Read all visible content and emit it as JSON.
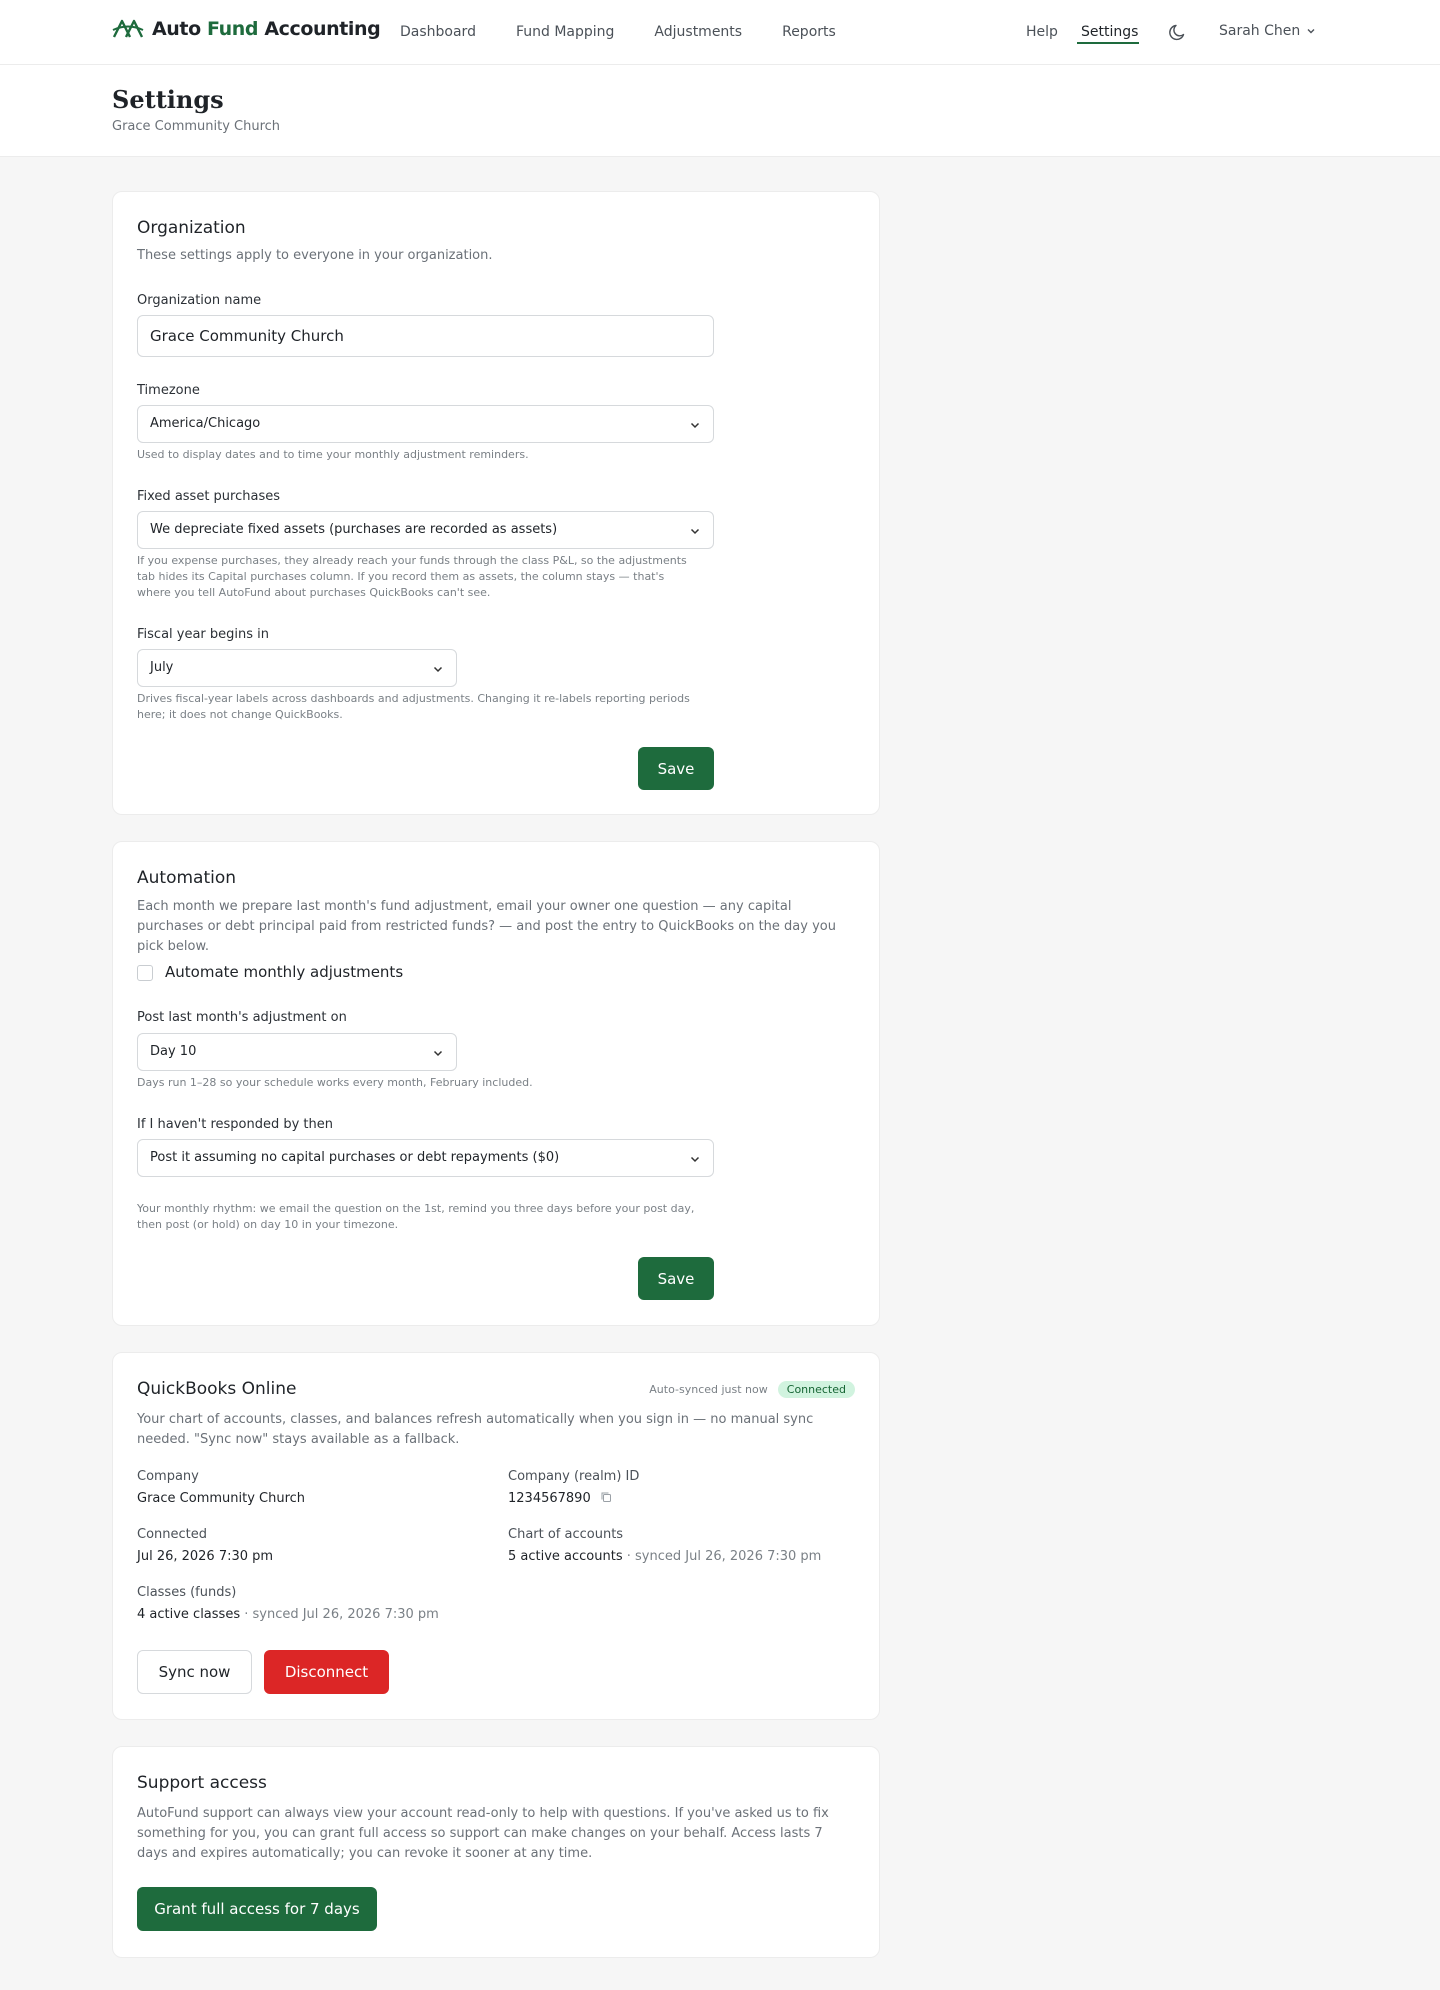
{
  "app": {
    "logo_prefix": "Auto",
    "logo_accent": "Fund",
    "logo_suffix": "Accounting",
    "brand_color": "#1e6b3d",
    "danger_color": "#dc2626"
  },
  "nav": {
    "links": [
      "Dashboard",
      "Fund Mapping",
      "Adjustments",
      "Reports"
    ],
    "help": "Help",
    "settings": "Settings",
    "theme_icon": "moon-icon",
    "user": "Sarah Chen"
  },
  "page": {
    "title": "Settings",
    "subtitle": "Grace Community Church"
  },
  "organization": {
    "title": "Organization",
    "description": "These settings apply to everyone in your organization.",
    "name_label": "Organization name",
    "name_value": "Grace Community Church",
    "timezone_label": "Timezone",
    "timezone_value": "America/Chicago",
    "timezone_help": "Used to display dates and to time your monthly adjustment reminders.",
    "fixed_asset_label": "Fixed asset purchases",
    "fixed_asset_value": "We depreciate fixed assets (purchases are recorded as assets)",
    "fixed_asset_help": "If you expense purchases, they already reach your funds through the class P&L, so the adjustments tab hides its Capital purchases column. If you record them as assets, the column stays — that's where you tell AutoFund about purchases QuickBooks can't see.",
    "fiscal_label": "Fiscal year begins in",
    "fiscal_value": "July",
    "fiscal_help": "Drives fiscal-year labels across dashboards and adjustments. Changing it re-labels reporting periods here; it does not change QuickBooks.",
    "save_label": "Save"
  },
  "automation": {
    "title": "Automation",
    "description": "Each month we prepare last month's fund adjustment, email your owner one question — any capital purchases or debt principal paid from restricted funds? — and post the entry to QuickBooks on the day you pick below.",
    "checkbox_label": "Automate monthly adjustments",
    "checkbox_checked": false,
    "post_label": "Post last month's adjustment on",
    "post_value": "Day 10",
    "post_help": "Days run 1–28 so your schedule works every month, February included.",
    "no_response_label": "If I haven't responded by then",
    "no_response_value": "Post it assuming no capital purchases or debt repayments ($0)",
    "rhythm_help": "Your monthly rhythm: we email the question on the 1st, remind you three days before your post day, then post (or hold) on day 10 in your timezone.",
    "save_label": "Save"
  },
  "quickbooks": {
    "title": "QuickBooks Online",
    "sync_status": "Auto-synced just now",
    "badge": "Connected",
    "description": "Your chart of accounts, classes, and balances refresh automatically when you sign in — no manual sync needed. \"Sync now\" stays available as a fallback.",
    "company_label": "Company",
    "company_value": "Grace Community Church",
    "realm_label": "Company (realm) ID",
    "realm_value": "1234567890",
    "connected_label": "Connected",
    "connected_value": "Jul 26, 2026 7:30 pm",
    "coa_label": "Chart of accounts",
    "coa_value": "5 active accounts",
    "coa_sync": " · synced Jul 26, 2026 7:30 pm",
    "classes_label": "Classes (funds)",
    "classes_value": "4 active classes",
    "classes_sync": " · synced Jul 26, 2026 7:30 pm",
    "sync_now_label": "Sync now",
    "disconnect_label": "Disconnect"
  },
  "support": {
    "title": "Support access",
    "description": "AutoFund support can always view your account read-only to help with questions. If you've asked us to fix something for you, you can grant full access so support can make changes on your behalf. Access lasts 7 days and expires automatically; you can revoke it sooner at any time.",
    "grant_label": "Grant full access for 7 days"
  }
}
